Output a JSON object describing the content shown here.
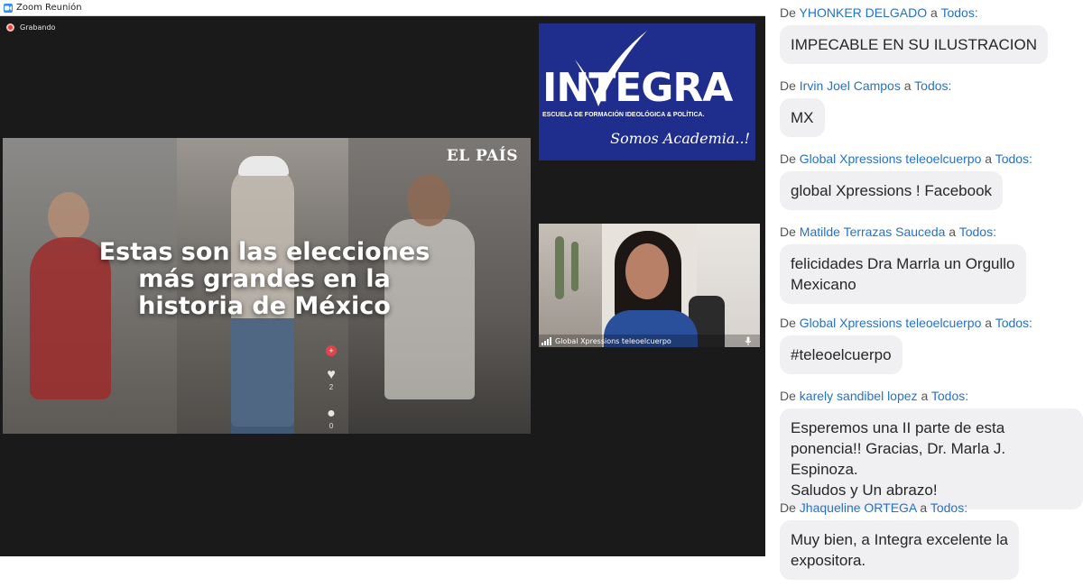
{
  "window": {
    "title": "Zoom Reunión",
    "icon": "zoom-logo-icon"
  },
  "recording": {
    "label": "Grabando",
    "color": "#e2433a"
  },
  "main_video": {
    "brand": "EL PAÍS",
    "headline": [
      "Estas son las elecciones",
      "más grandes en la",
      "historia de México"
    ],
    "icons": {
      "plus": "+",
      "like": "♥",
      "like_count": "2",
      "comment": "●",
      "comment_count": "0"
    }
  },
  "integra_tile": {
    "name": "INTEGRA",
    "subtitle": "ESCUELA DE FORMACIÓN IDEOLÓGICA & POLÍTICA.",
    "slogan": "Somos Academia..!",
    "bg_color": "#1f2d8c"
  },
  "participant_tile": {
    "name": "Global Xpressions teleoelcuerpo"
  },
  "chat": {
    "from_word": "De",
    "to_word": "a",
    "messages": [
      {
        "sender": "YHONKER DELGADO",
        "recipient": "Todos:",
        "text": [
          "IMPECABLE EN SU ILUSTRACION"
        ]
      },
      {
        "sender": "Irvin Joel Campos",
        "recipient": "Todos:",
        "text": [
          "MX"
        ]
      },
      {
        "sender": "Global Xpressions teleoelcuerpo",
        "recipient": "Todos:",
        "text": [
          "global Xpressions ! Facebook"
        ]
      },
      {
        "sender": "Matilde Terrazas Sauceda",
        "recipient": "Todos:",
        "text": [
          "felicidades Dra Marrla un Orgullo",
          "Mexicano"
        ]
      },
      {
        "sender": "Global Xpressions teleoelcuerpo",
        "recipient": "Todos:",
        "text": [
          "#teleoelcuerpo"
        ]
      },
      {
        "sender": "karely sandibel lopez",
        "recipient": "Todos:",
        "text": [
          "Esperemos una II parte de esta",
          "ponencia!! Gracias, Dr. Marla J. Espinoza.",
          "Saludos y Un abrazo!"
        ]
      },
      {
        "sender": "Jhaqueline ORTEGA",
        "recipient": "Todos:",
        "text": [
          "Muy bien, a Integra excelente la",
          "expositora."
        ]
      }
    ],
    "link_color": "#2472c8",
    "bubble_color": "#f0f0f2"
  }
}
